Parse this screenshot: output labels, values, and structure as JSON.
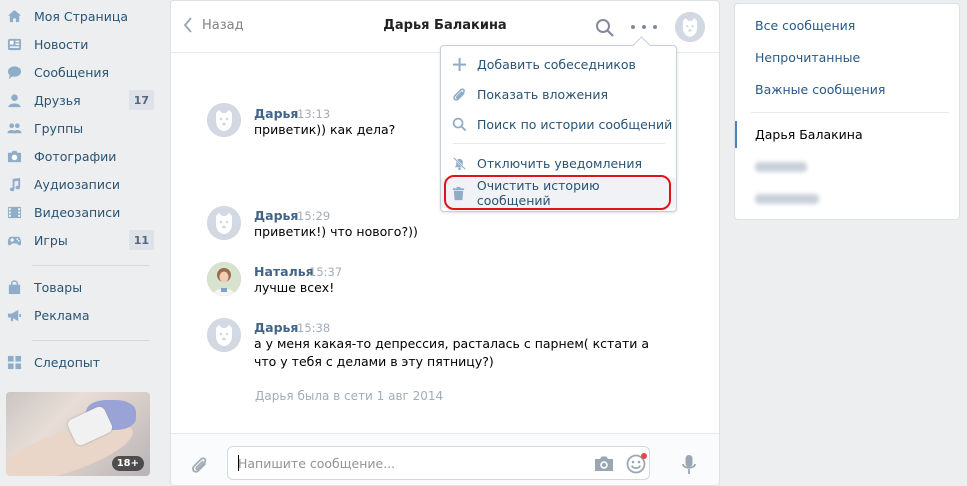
{
  "sidebar": {
    "items": [
      {
        "label": "Моя Страница",
        "icon": "home-icon"
      },
      {
        "label": "Новости",
        "icon": "news-icon"
      },
      {
        "label": "Сообщения",
        "icon": "messages-icon"
      },
      {
        "label": "Друзья",
        "icon": "friends-icon",
        "count": "17"
      },
      {
        "label": "Группы",
        "icon": "groups-icon"
      },
      {
        "label": "Фотографии",
        "icon": "camera-icon"
      },
      {
        "label": "Аудиозаписи",
        "icon": "music-icon"
      },
      {
        "label": "Видеозаписи",
        "icon": "video-icon"
      },
      {
        "label": "Игры",
        "icon": "gamepad-icon",
        "count": "11"
      },
      {
        "label": "Товары",
        "icon": "bag-icon"
      },
      {
        "label": "Реклама",
        "icon": "megaphone-icon"
      },
      {
        "label": "Следопыт",
        "icon": "apps-grid-icon"
      }
    ],
    "ad_badge": "18+"
  },
  "chat": {
    "back_label": "Назад",
    "peer_name": "Дарья Балакина",
    "messages": [
      {
        "author": "Дарья",
        "time": "13:13",
        "lines": [
          "приветик)) как дела?"
        ]
      },
      {
        "author": "Дарья",
        "time": "15:29",
        "lines": [
          "приветик!) что нового?))"
        ]
      },
      {
        "author": "Наталья",
        "time": "15:37",
        "lines": [
          "лучше всех!"
        ]
      },
      {
        "author": "Дарья",
        "time": "15:38",
        "lines": [
          "а у меня какая-то депрессия, расталась с парнем( кстати а",
          "что у тебя с делами в эту пятницу?)"
        ]
      }
    ],
    "last_seen": "Дарья была в сети 1 авг 2014",
    "composer_placeholder": "Напишите сообщение..."
  },
  "menu": {
    "items": [
      {
        "label": "Добавить собеседников",
        "icon": "plus-icon"
      },
      {
        "label": "Показать вложения",
        "icon": "paperclip-icon"
      },
      {
        "label": "Поиск по истории сообщений",
        "icon": "search-icon"
      },
      {
        "label": "Отключить уведомления",
        "icon": "bell-off-icon"
      },
      {
        "label": "Очистить историю сообщений",
        "icon": "trash-icon"
      }
    ],
    "highlight_color": "#e0131b"
  },
  "right_panel": {
    "filters": [
      "Все сообщения",
      "Непрочитанные",
      "Важные сообщения"
    ],
    "active_dialog": "Дарья Балакина"
  },
  "colors": {
    "link": "#285473",
    "author": "#42648b",
    "accent": "#5181b8"
  }
}
